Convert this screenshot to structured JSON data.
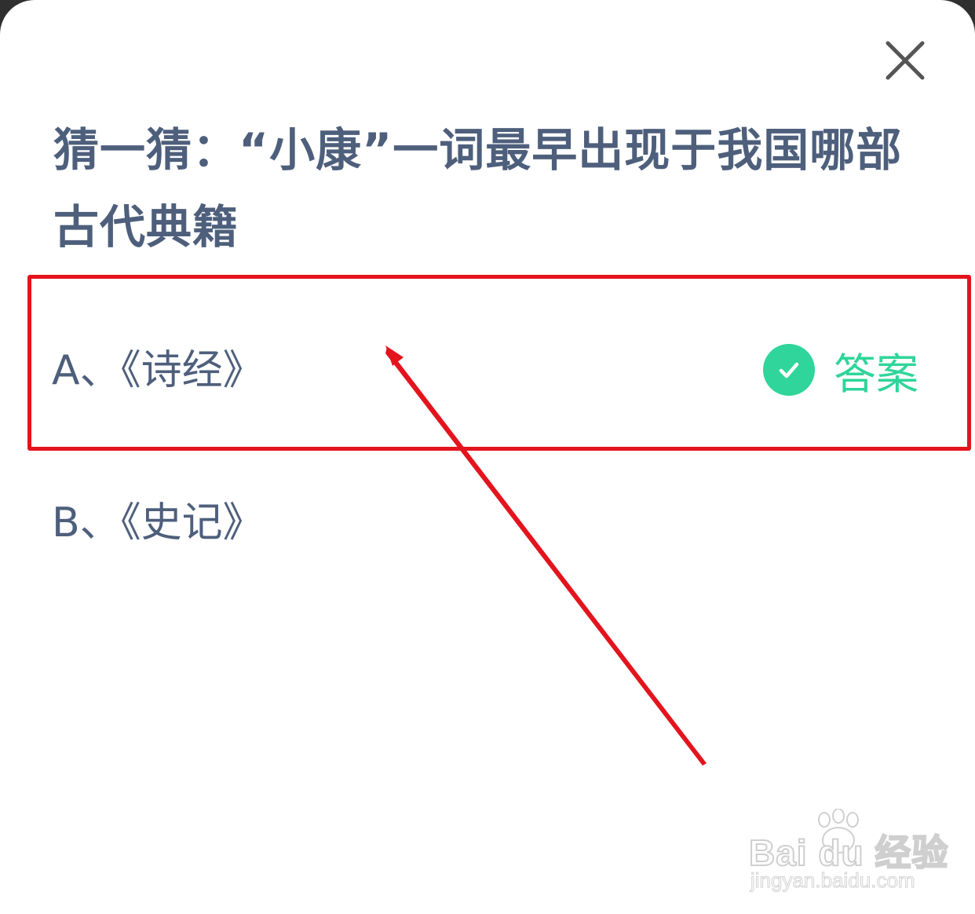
{
  "dialog": {
    "close_icon": "close-icon",
    "question": "猜一猜：“小康”一词最早出现于我国哪部古代典籍",
    "options": [
      {
        "label": "A、《诗经》",
        "is_answer": true
      },
      {
        "label": "B、《史记》",
        "is_answer": false
      }
    ],
    "answer_badge": {
      "icon": "check-circle-icon",
      "text": "答案"
    }
  },
  "annotations": {
    "highlight_color": "#e3141d",
    "arrow_color": "#e3141d"
  },
  "watermark": {
    "logo_text": "Bai du 经验",
    "url": "jingyan.baidu.com"
  },
  "colors": {
    "text": "#4e5f7c",
    "answer_green": "#2fd59a",
    "close_gray": "#555555"
  }
}
